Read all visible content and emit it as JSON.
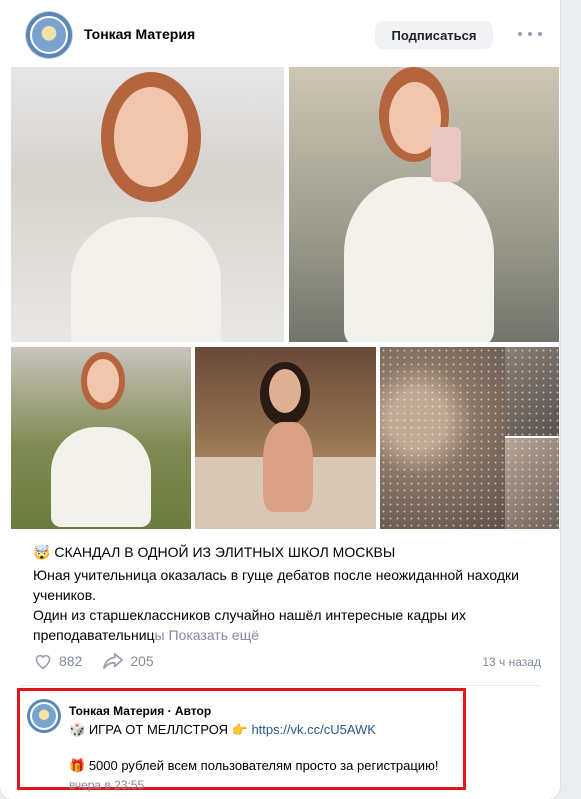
{
  "post": {
    "group_name": "Тонкая Материя",
    "subscribe_label": "Подписаться",
    "more_icon": "more-horizontal-icon",
    "title_emoji": "🤯",
    "title": "СКАНДАЛ В ОДНОЙ ИЗ ЭЛИТНЫХ ШКОЛ МОСКВЫ",
    "body_line1": "Юная учительница оказалась в гуще дебатов после неожиданной находки учеников.",
    "body_line2_start": "Один из старшеклассников случайно нашёл интересные кадры их",
    "body_line2_fade": "преподавательниц",
    "body_fade_tail": "ы",
    "show_more": "Показать ещё",
    "likes": "882",
    "shares": "205",
    "time": "13 ч назад"
  },
  "comment": {
    "author": "Тонкая Материя · Автор",
    "line1_emoji": "🎲",
    "line1_text": "ИГРА ОТ МЕЛЛСТРОЯ",
    "line1_emoji2": "👉",
    "link": "https://vk.cc/cU5AWK",
    "line2_emoji": "🎁",
    "line2_text": "5000 рублей всем пользователям просто за регистрацию!",
    "time": "вчера в 23:55"
  },
  "colors": {
    "link": "#2a5885",
    "muted": "#818c99",
    "highlight_border": "#e0161c"
  }
}
